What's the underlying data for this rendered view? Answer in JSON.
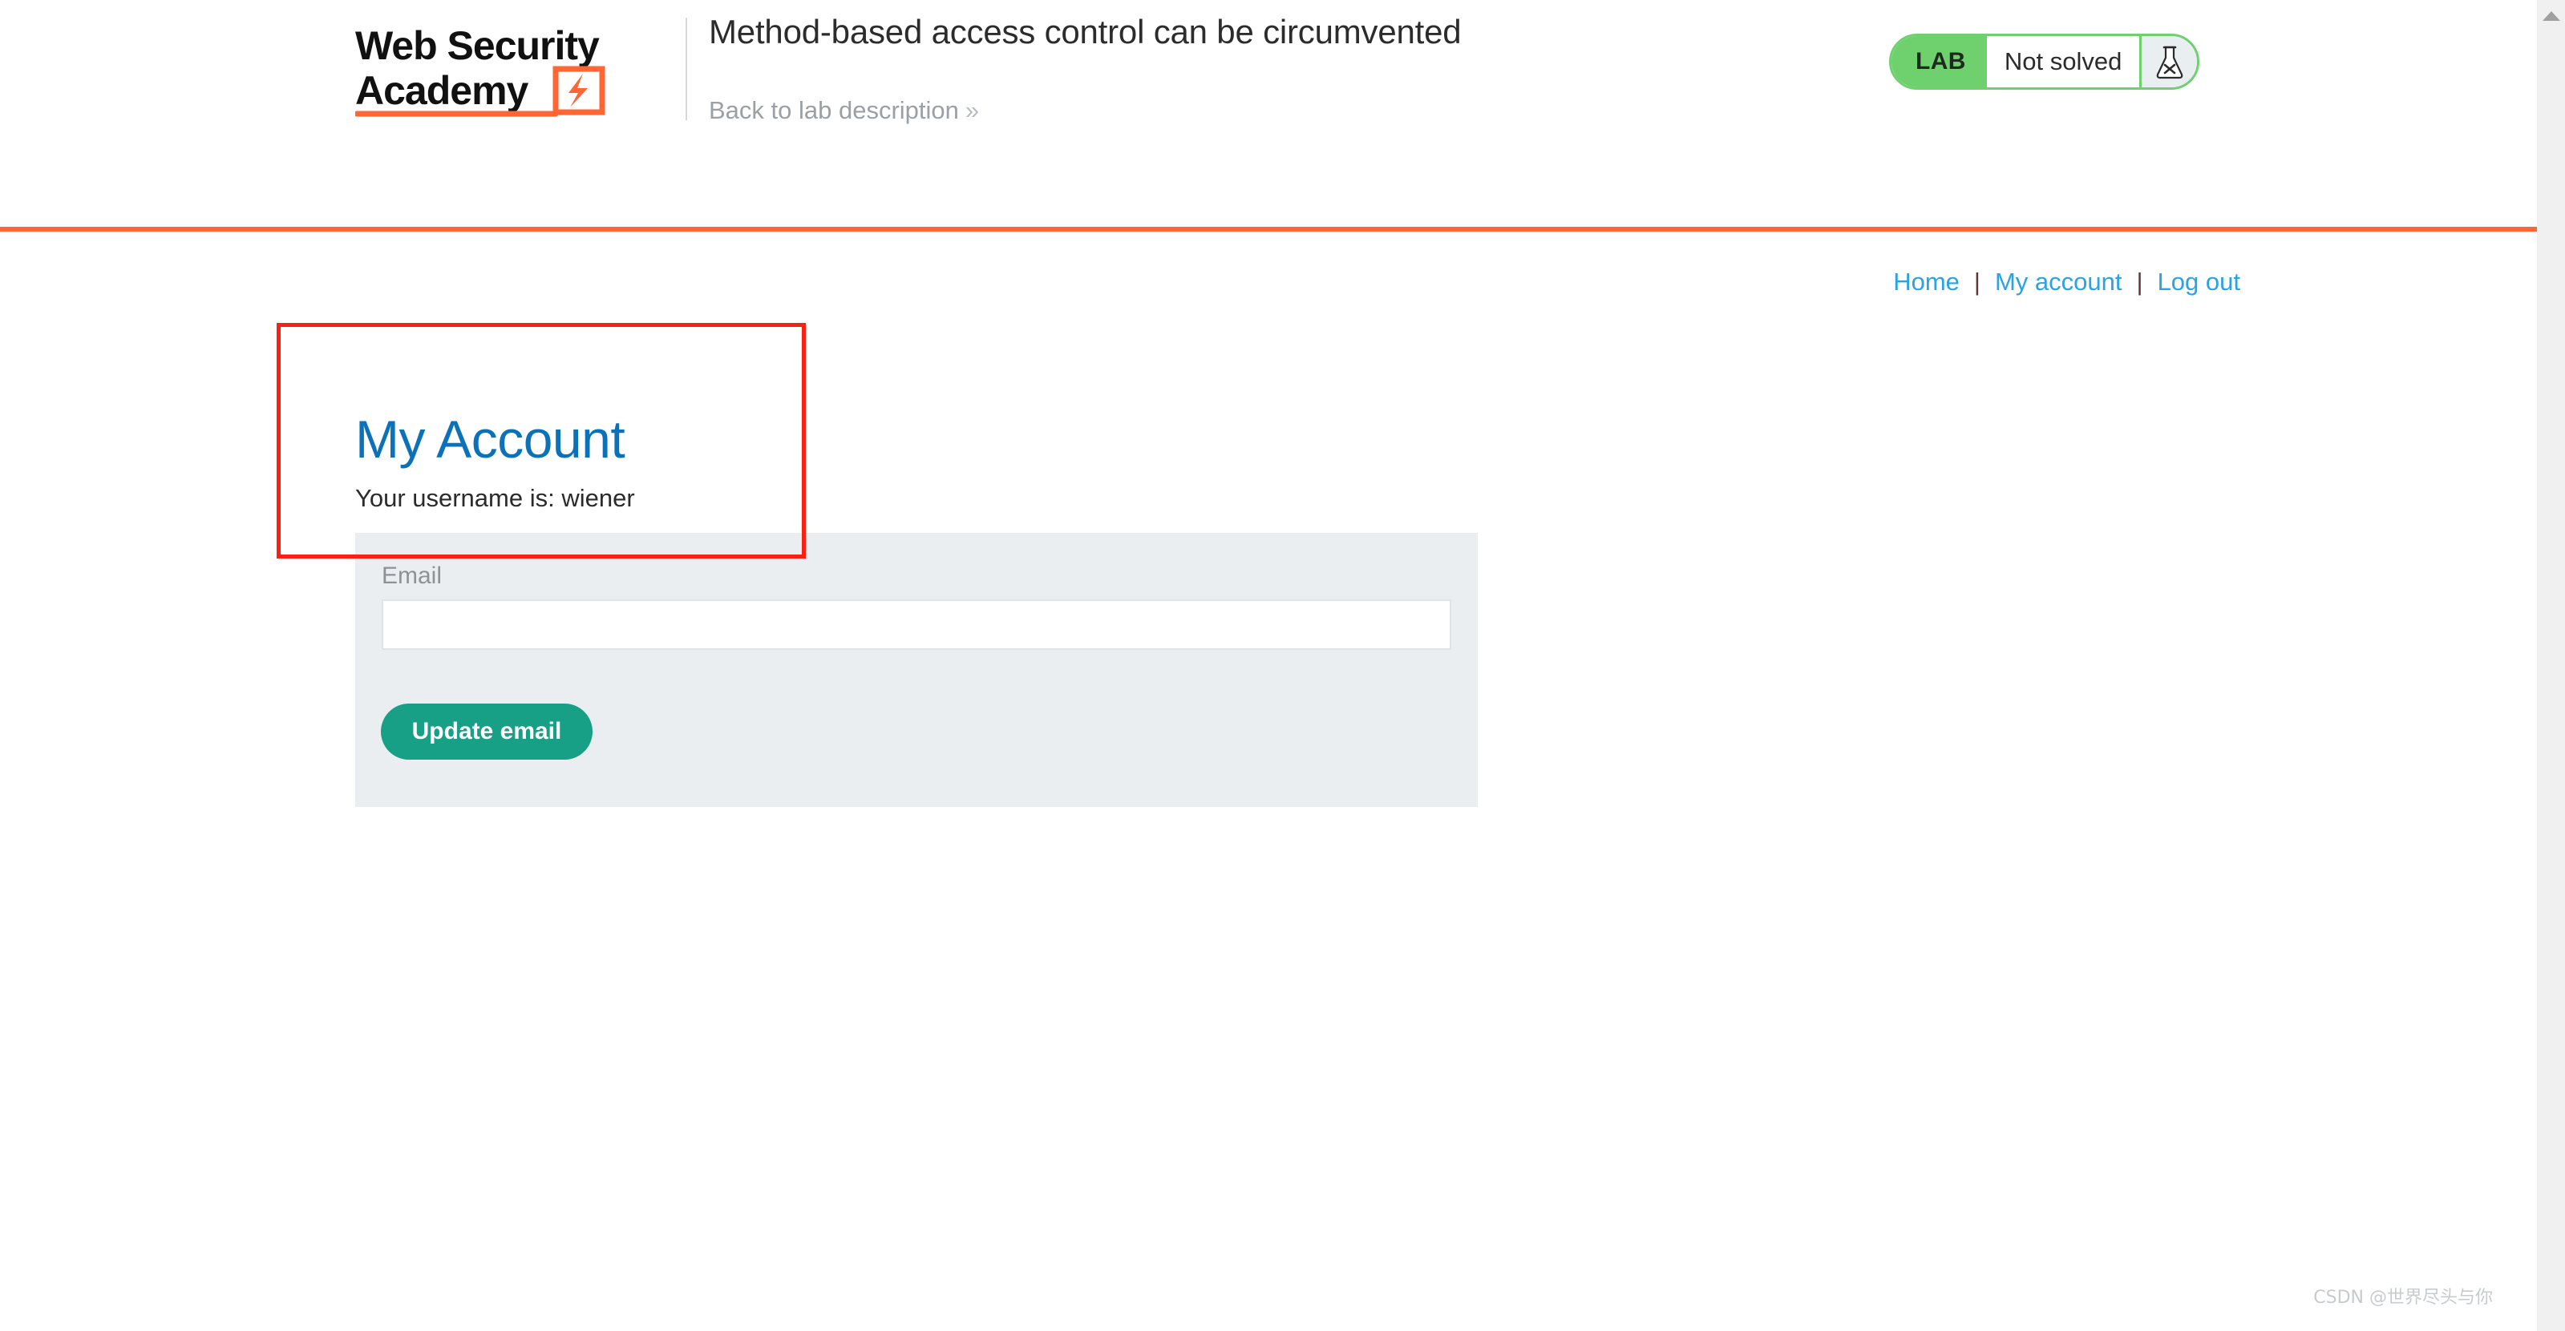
{
  "header": {
    "logo": {
      "line1": "Web Security",
      "line2": "Academy",
      "mark": "lightning-bolt-mark"
    },
    "lab_title": "Method-based access control can be circumvented",
    "back_link": "Back to lab description",
    "back_link_chevron": "»",
    "status": {
      "tag": "LAB",
      "text": "Not solved",
      "icon": "flask-x-icon"
    }
  },
  "colors": {
    "accent_orange": "#ff6633",
    "status_green": "#6ed16e",
    "heading_blue": "#0b72b9",
    "link_blue": "#29a3e3",
    "button_teal": "#17a086",
    "panel_grey": "#ebeef0",
    "annotation_red": "#fa2012"
  },
  "nav": {
    "links": [
      {
        "label": "Home"
      },
      {
        "label": "My account"
      },
      {
        "label": "Log out"
      }
    ],
    "separator": "|"
  },
  "account": {
    "heading": "My Account",
    "username_line": "Your username is: wiener"
  },
  "form": {
    "email_label": "Email",
    "email_value": "",
    "email_placeholder": "",
    "submit_label": "Update email"
  },
  "watermark": {
    "text": "CSDN @世界尽头与你"
  }
}
